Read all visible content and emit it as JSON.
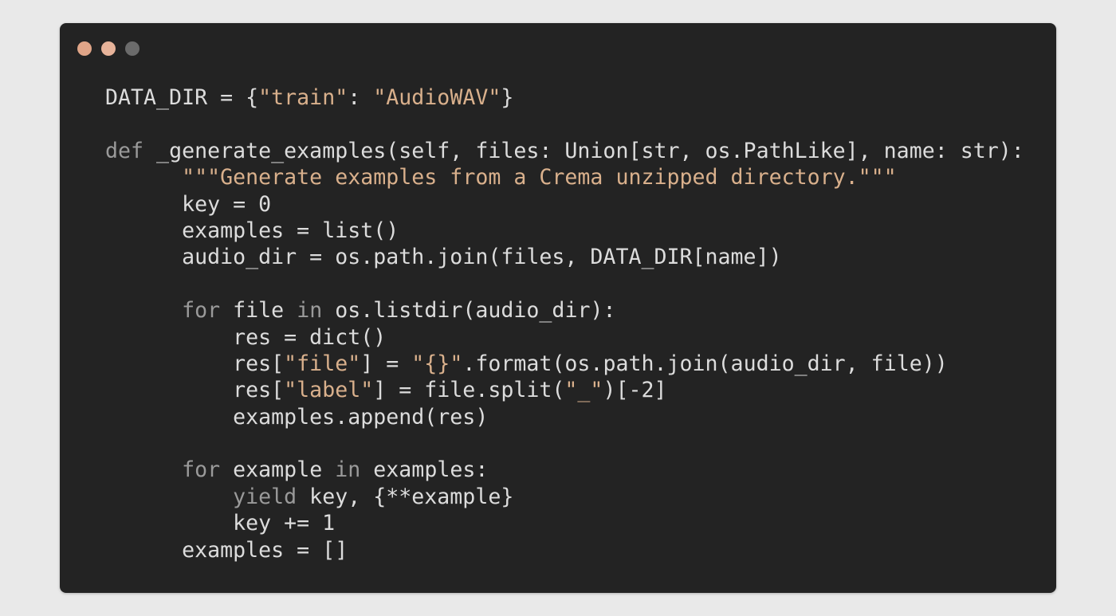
{
  "window": {
    "background": "#232323",
    "dots": [
      {
        "name": "close-dot",
        "color": "#e0a588"
      },
      {
        "name": "minimize-dot",
        "color": "#e7b39a"
      },
      {
        "name": "zoom-dot",
        "color": "#6b6b6b"
      }
    ]
  },
  "code": {
    "colors": {
      "plain": "#dcdcdc",
      "keyword": "#9a9a9a",
      "string": "#d9b08c"
    },
    "lines": [
      {
        "indent": 0,
        "tokens": [
          [
            "plain",
            "DATA_DIR = {"
          ],
          [
            "str",
            "\"train\""
          ],
          [
            "plain",
            ": "
          ],
          [
            "str",
            "\"AudioWAV\""
          ],
          [
            "plain",
            "}"
          ]
        ]
      },
      {
        "indent": 0,
        "tokens": []
      },
      {
        "indent": 0,
        "tokens": [
          [
            "kw",
            "def"
          ],
          [
            "plain",
            " _generate_examples(self, files: Union[str, os.PathLike], name: str):"
          ]
        ]
      },
      {
        "indent": 3,
        "tokens": [
          [
            "str",
            "\"\"\"Generate examples from a Crema unzipped directory.\"\"\""
          ]
        ]
      },
      {
        "indent": 3,
        "tokens": [
          [
            "plain",
            "key = 0"
          ]
        ]
      },
      {
        "indent": 3,
        "tokens": [
          [
            "plain",
            "examples = list()"
          ]
        ]
      },
      {
        "indent": 3,
        "tokens": [
          [
            "plain",
            "audio_dir = os.path.join(files, DATA_DIR[name])"
          ]
        ]
      },
      {
        "indent": 0,
        "tokens": []
      },
      {
        "indent": 3,
        "tokens": [
          [
            "kw",
            "for"
          ],
          [
            "plain",
            " file "
          ],
          [
            "kw",
            "in"
          ],
          [
            "plain",
            " os.listdir(audio_dir):"
          ]
        ]
      },
      {
        "indent": 5,
        "tokens": [
          [
            "plain",
            "res = dict()"
          ]
        ]
      },
      {
        "indent": 5,
        "tokens": [
          [
            "plain",
            "res["
          ],
          [
            "str",
            "\"file\""
          ],
          [
            "plain",
            "] = "
          ],
          [
            "str",
            "\"{}\""
          ],
          [
            "plain",
            ".format(os.path.join(audio_dir, file))"
          ]
        ]
      },
      {
        "indent": 5,
        "tokens": [
          [
            "plain",
            "res["
          ],
          [
            "str",
            "\"label\""
          ],
          [
            "plain",
            "] = file.split("
          ],
          [
            "str",
            "\"_\""
          ],
          [
            "plain",
            ")[-2]"
          ]
        ]
      },
      {
        "indent": 5,
        "tokens": [
          [
            "plain",
            "examples.append(res)"
          ]
        ]
      },
      {
        "indent": 0,
        "tokens": []
      },
      {
        "indent": 3,
        "tokens": [
          [
            "kw",
            "for"
          ],
          [
            "plain",
            " example "
          ],
          [
            "kw",
            "in"
          ],
          [
            "plain",
            " examples:"
          ]
        ]
      },
      {
        "indent": 5,
        "tokens": [
          [
            "kw",
            "yield"
          ],
          [
            "plain",
            " key, {**example}"
          ]
        ]
      },
      {
        "indent": 5,
        "tokens": [
          [
            "plain",
            "key += 1"
          ]
        ]
      },
      {
        "indent": 3,
        "tokens": [
          [
            "plain",
            "examples = []"
          ]
        ]
      }
    ]
  }
}
